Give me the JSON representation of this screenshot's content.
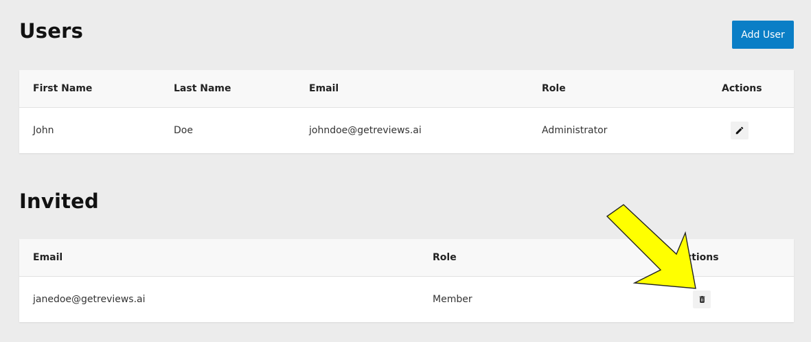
{
  "users": {
    "title": "Users",
    "add_button": "Add User",
    "columns": [
      "First Name",
      "Last Name",
      "Email",
      "Role",
      "Actions"
    ],
    "rows": [
      {
        "first_name": "John",
        "last_name": "Doe",
        "email": "johndoe@getreviews.ai",
        "role": "Administrator",
        "action_icon": "pencil-icon"
      }
    ]
  },
  "invited": {
    "title": "Invited",
    "columns": [
      "Email",
      "Role",
      "Actions"
    ],
    "rows": [
      {
        "email": "janedoe@getreviews.ai",
        "role": "Member",
        "action_icon": "trash-icon"
      }
    ]
  },
  "colors": {
    "accent": "#0a7ec6",
    "annotation_arrow": "#ffff00"
  }
}
